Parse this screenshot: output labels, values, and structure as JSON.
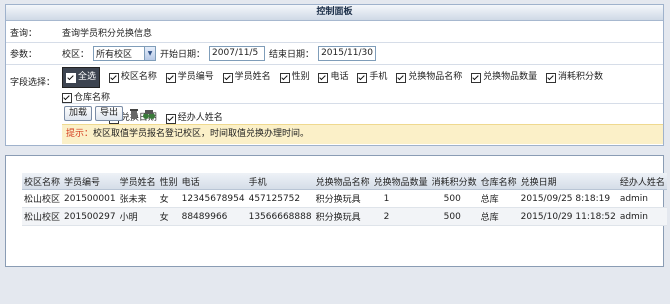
{
  "panel": {
    "title": "控制面板"
  },
  "query": {
    "label": "查询：",
    "value": "查询学员积分兑换信息"
  },
  "params": {
    "label": "参数：",
    "campus_label": "校区：",
    "campus_value": "所有校区",
    "start_label": "开始日期：",
    "start_value": "2007/11/5",
    "end_label": "结束日期：",
    "end_value": "2015/11/30"
  },
  "fields": {
    "label": "字段选择：",
    "select_all": "全选",
    "options": [
      "校区名称",
      "学员编号",
      "学员姓名",
      "性别",
      "电话",
      "手机",
      "兑换物品名称",
      "兑换物品数量",
      "消耗积分数",
      "仓库名称",
      "兑换日期",
      "经办人姓名"
    ]
  },
  "actions": {
    "load": "加载",
    "export": "导出"
  },
  "tip": {
    "label": "提示：",
    "text": "校区取值学员报名登记校区，时间取值兑换办理时间。"
  },
  "table": {
    "headers": [
      "校区名称",
      "学员编号",
      "学员姓名",
      "性别",
      "电话",
      "手机",
      "兑换物品名称",
      "兑换物品数量",
      "消耗积分数",
      "仓库名称",
      "兑换日期",
      "经办人姓名"
    ],
    "rows": [
      [
        "松山校区",
        "201500001",
        "张未来",
        "女",
        "12345678954",
        "457125752",
        "积分换玩具",
        "1",
        "500",
        "总库",
        "2015/09/25 8:18:19",
        "admin"
      ],
      [
        "松山校区",
        "201500297",
        "小明",
        "女",
        "88489966",
        "13566668888",
        "积分换玩具",
        "2",
        "500",
        "总库",
        "2015/10/29 11:18:52",
        "admin"
      ]
    ]
  }
}
